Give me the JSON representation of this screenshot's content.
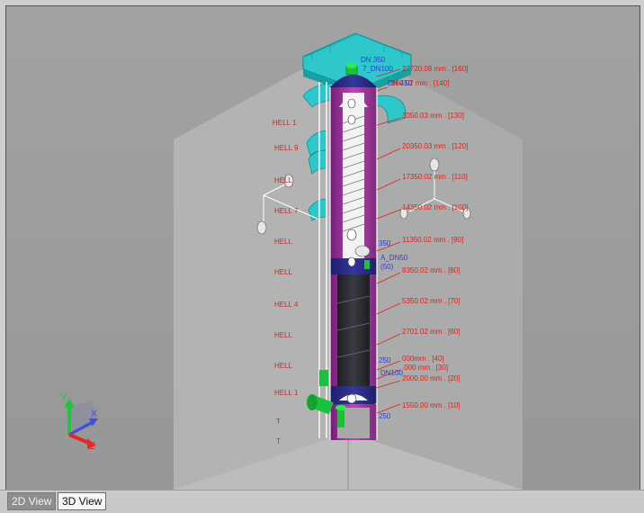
{
  "tabs": [
    {
      "label": "2D View",
      "active": false
    },
    {
      "label": "3D View",
      "active": true
    }
  ],
  "nozzle_labels": [
    {
      "text": "DN 350"
    },
    {
      "text": "7_DN100"
    },
    {
      "text": "DN 450"
    },
    {
      "text": "350"
    },
    {
      "text": "A_DN50"
    },
    {
      "text": "(50)"
    },
    {
      "text": "250"
    },
    {
      "text": "DN100"
    },
    {
      "text": "250"
    }
  ],
  "elevation_labels": [
    {
      "text": "27720.08 mm . [160]"
    },
    {
      "text": "360.02 mm . [140]"
    },
    {
      "text": "3350.03 mm . [130]"
    },
    {
      "text": "20350.03 mm . [120]"
    },
    {
      "text": "17350.02 mm . [110]"
    },
    {
      "text": "14350.02 mm . [100]"
    },
    {
      "text": "11350.02 mm . [90]"
    },
    {
      "text": "8350.02 mm . [80]"
    },
    {
      "text": "5350.02 mm . [70]"
    },
    {
      "text": "2701.02 mm . [60]"
    },
    {
      "text": "000mm . [40]"
    },
    {
      "text": ".000 mm . [30]"
    },
    {
      "text": "2000.00 mm . [20]"
    },
    {
      "text": "1550.00 mm . [10]"
    }
  ],
  "shell_labels": [
    {
      "text": "HELL 1"
    },
    {
      "text": "HELL 9"
    },
    {
      "text": "HELL"
    },
    {
      "text": "HELL 7"
    },
    {
      "text": "HELL"
    },
    {
      "text": "HELL"
    },
    {
      "text": "HELL 4"
    },
    {
      "text": "HELL"
    },
    {
      "text": "HELL"
    },
    {
      "text": "HELL 1"
    },
    {
      "text": "T"
    },
    {
      "text": "T"
    }
  ],
  "axis_labels": {
    "x": "X",
    "y": "Y",
    "z": "Z"
  },
  "colors": {
    "viewport_bg": "#9c9c9c",
    "wall": "#b0b0b0",
    "platform": "#2ec8cc",
    "skirt_dark": "#2d2d33",
    "shell_magenta": "#a8349f",
    "shell_navy": "#2c2d88",
    "label_red": "#e0201a",
    "label_blue": "#2a3fd0",
    "nozzle_green": "#19c23a"
  }
}
